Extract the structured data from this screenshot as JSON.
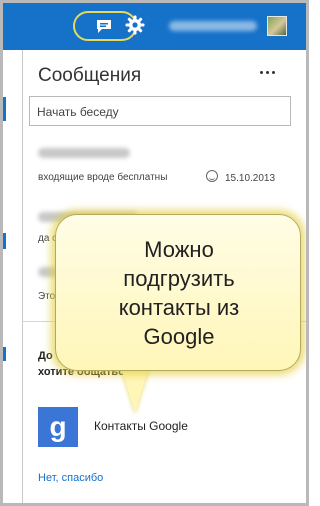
{
  "topbar": {
    "messages_icon": "chat-bubble-icon",
    "settings_icon": "gear-icon"
  },
  "panel": {
    "title": "Сообщения",
    "search_placeholder": "Начать беседу",
    "conversations": [
      {
        "preview": "входящие вроде бесплатны",
        "date": "15.10.2013"
      },
      {
        "preview": "да с"
      },
      {
        "preview": "Это"
      }
    ],
    "google_prompt": {
      "line1": "До",
      "line2": "хотите общаться"
    },
    "google_contacts_label": "Контакты Google",
    "no_thanks": "Нет, спасибо"
  },
  "callout": {
    "line1": "Можно",
    "line2": "подгрузить",
    "line3": "контакты из",
    "line4": "Google"
  },
  "colors": {
    "accent": "#1672c9",
    "callout_bg": "#fff6b8"
  }
}
